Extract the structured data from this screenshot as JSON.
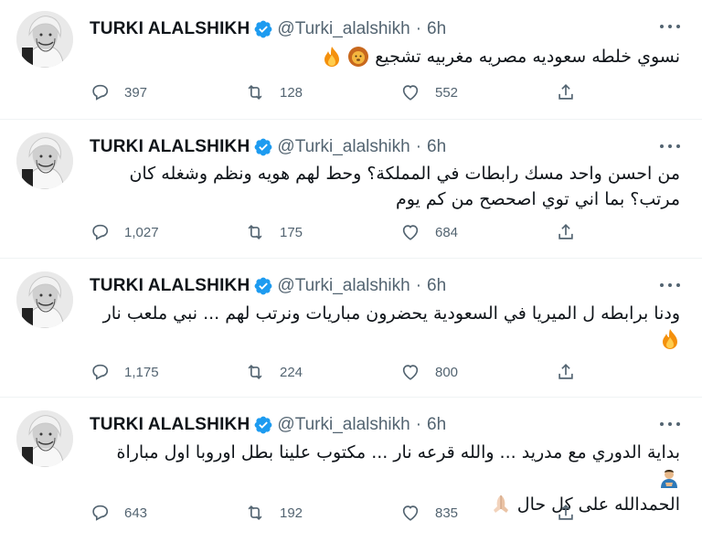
{
  "tweets": [
    {
      "author_name": "TURKI ALALSHIKH",
      "handle": "@Turki_alalshikh",
      "separator": "·",
      "time": "6h",
      "text_lines": [
        "نسوي خلطه سعوديه مصريه مغربيه تشجيع"
      ],
      "emojis": [
        "lion",
        "fire"
      ],
      "replies": "397",
      "retweets": "128",
      "likes": "552"
    },
    {
      "author_name": "TURKI ALALSHIKH",
      "handle": "@Turki_alalshikh",
      "separator": "·",
      "time": "6h",
      "text_lines": [
        "من احسن واحد مسك رابطات في المملكة؟ وحط لهم هويه ونظم وشغله كان",
        "مرتب؟ بما اني توي اصحصح من كم يوم"
      ],
      "emojis": [],
      "replies": "1,027",
      "retweets": "175",
      "likes": "684"
    },
    {
      "author_name": "TURKI ALALSHIKH",
      "handle": "@Turki_alalshikh",
      "separator": "·",
      "time": "6h",
      "text_lines": [
        "ودنا برابطه ل الميريا في السعودية يحضرون مباريات ونرتب لهم ... نبي ملعب نار"
      ],
      "emojis": [
        "fire"
      ],
      "replies": "1,175",
      "retweets": "224",
      "likes": "800"
    },
    {
      "author_name": "TURKI ALALSHIKH",
      "handle": "@Turki_alalshikh",
      "separator": "·",
      "time": "6h",
      "text_lines": [
        "بداية الدوري مع مدريد ... والله قرعه نار ... مكتوب علينا بطل اوروبا اول مباراة",
        "الحمدالله على كل حال"
      ],
      "emojis": [
        "man-bowing",
        "folded-hands"
      ],
      "replies": "643",
      "retweets": "192",
      "likes": "835"
    }
  ],
  "icons": {
    "verified": "verified-badge-icon",
    "reply": "reply-icon",
    "retweet": "retweet-icon",
    "like": "heart-icon",
    "share": "share-icon",
    "more": "more-icon"
  },
  "colors": {
    "verified_blue": "#1d9bf0",
    "icon_gray": "#536471",
    "text_dark": "#0f1419",
    "divider": "#eff3f4"
  }
}
